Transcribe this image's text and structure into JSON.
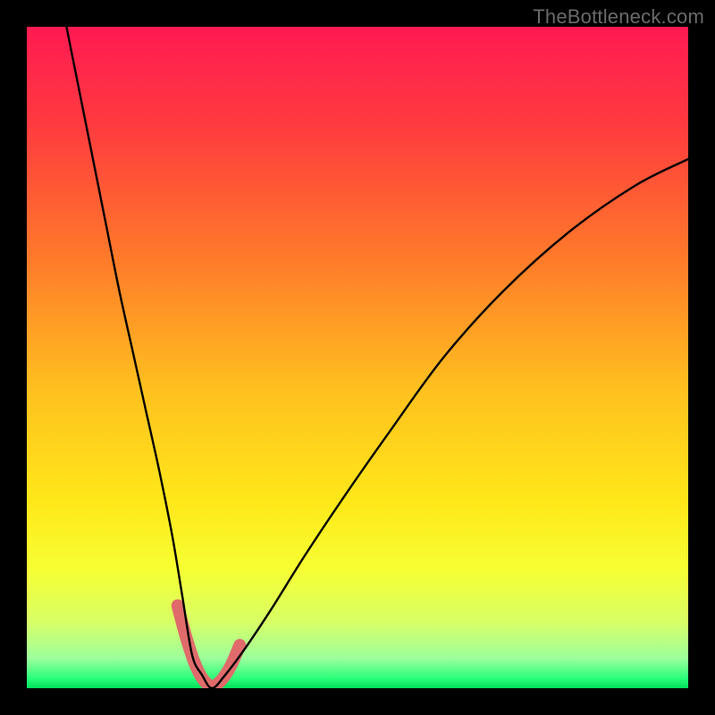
{
  "watermark": "TheBottleneck.com",
  "chart_data": {
    "type": "line",
    "title": "",
    "xlabel": "",
    "ylabel": "",
    "xlim": [
      0,
      100
    ],
    "ylim": [
      0,
      100
    ],
    "gradient_stops": [
      {
        "offset": 0.0,
        "color": "#ff1a52"
      },
      {
        "offset": 0.15,
        "color": "#ff3b3f"
      },
      {
        "offset": 0.35,
        "color": "#ff7a2a"
      },
      {
        "offset": 0.55,
        "color": "#ffc11f"
      },
      {
        "offset": 0.72,
        "color": "#ffe81a"
      },
      {
        "offset": 0.82,
        "color": "#f6ff33"
      },
      {
        "offset": 0.9,
        "color": "#d8ff66"
      },
      {
        "offset": 0.955,
        "color": "#9cff9c"
      },
      {
        "offset": 0.985,
        "color": "#2bff7a"
      },
      {
        "offset": 1.0,
        "color": "#00e05a"
      }
    ],
    "series": [
      {
        "name": "bottleneck-curve",
        "color": "#000000",
        "x": [
          6,
          8,
          10,
          12,
          14,
          16,
          18,
          20,
          22,
          23.5,
          25,
          26.5,
          28,
          30,
          33,
          37,
          42,
          48,
          55,
          63,
          72,
          82,
          92,
          100
        ],
        "y": [
          100,
          90,
          80,
          70,
          60,
          51,
          42,
          33,
          23,
          14,
          5,
          2,
          0,
          2,
          6,
          12,
          20,
          29,
          39,
          50,
          60,
          69,
          76,
          80
        ]
      }
    ],
    "highlight_segment": {
      "name": "curve-bottom-marker",
      "color": "#e06b6b",
      "width": 14,
      "x": [
        22.8,
        24.0,
        25.3,
        26.6,
        28.0,
        29.4,
        30.8,
        32.2
      ],
      "y": [
        12.5,
        8.0,
        4.0,
        1.4,
        0.3,
        1.2,
        3.3,
        6.5
      ]
    }
  }
}
